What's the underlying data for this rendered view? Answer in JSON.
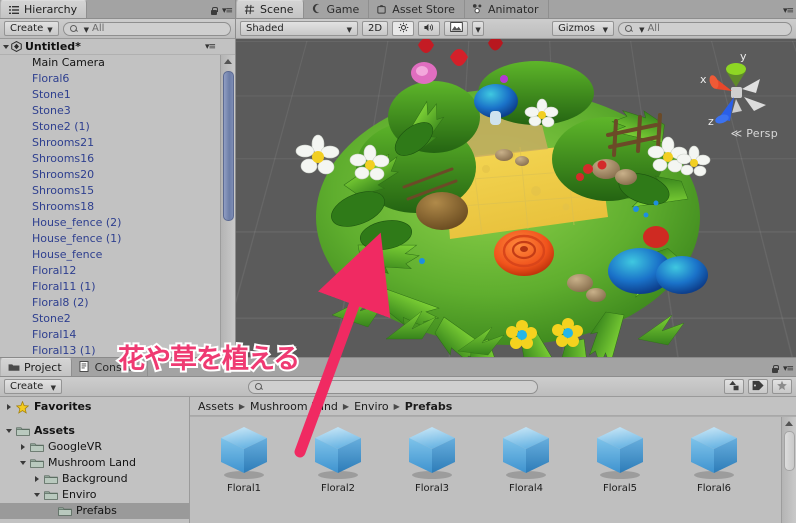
{
  "hierarchy": {
    "tab_label": "Hierarchy",
    "tab_icon": "hierarchy-icon",
    "create_label": "Create",
    "search_placeholder": "All",
    "scene_name": "Untitled*",
    "items": [
      {
        "label": "Main Camera",
        "kind": "gameobject"
      },
      {
        "label": "Floral6",
        "kind": "prefab"
      },
      {
        "label": "Stone1",
        "kind": "prefab"
      },
      {
        "label": "Stone3",
        "kind": "prefab"
      },
      {
        "label": "Stone2 (1)",
        "kind": "prefab"
      },
      {
        "label": "Shrooms21",
        "kind": "prefab"
      },
      {
        "label": "Shrooms16",
        "kind": "prefab"
      },
      {
        "label": "Shrooms20",
        "kind": "prefab"
      },
      {
        "label": "Shrooms15",
        "kind": "prefab"
      },
      {
        "label": "Shrooms18",
        "kind": "prefab"
      },
      {
        "label": "House_fence (2)",
        "kind": "prefab"
      },
      {
        "label": "House_fence (1)",
        "kind": "prefab"
      },
      {
        "label": "House_fence",
        "kind": "prefab"
      },
      {
        "label": "Floral12",
        "kind": "prefab"
      },
      {
        "label": "Floral11 (1)",
        "kind": "prefab"
      },
      {
        "label": "Floral8 (2)",
        "kind": "prefab"
      },
      {
        "label": "Stone2",
        "kind": "prefab"
      },
      {
        "label": "Floral14",
        "kind": "prefab"
      },
      {
        "label": "Floral13 (1)",
        "kind": "prefab"
      }
    ]
  },
  "scene_panel": {
    "tabs": [
      {
        "label": "Scene",
        "icon": "grid-icon",
        "active": true
      },
      {
        "label": "Game",
        "icon": "gamepad-icon",
        "active": false
      },
      {
        "label": "Asset Store",
        "icon": "store-bag-icon",
        "active": false
      },
      {
        "label": "Animator",
        "icon": "animator-icon",
        "active": false
      }
    ],
    "toolbar": {
      "draw_mode": "Shaded",
      "two_d_label": "2D",
      "lighting_icon": "sun-icon",
      "audio_icon": "speaker-icon",
      "fx_icon": "image-icon",
      "gizmos_label": "Gizmos",
      "search_placeholder": "All"
    },
    "gizmo": {
      "x_label": "x",
      "y_label": "y",
      "z_label": "z",
      "projection_label": "Persp",
      "x_color": "#e8472a",
      "y_color": "#8ed624",
      "z_color": "#2a5fe8"
    }
  },
  "project": {
    "tabs": [
      {
        "label": "Project",
        "icon": "folder-icon",
        "active": true
      },
      {
        "label": "Console",
        "icon": "console-icon",
        "active": false
      }
    ],
    "create_label": "Create",
    "search_placeholder": "",
    "filter_icons": [
      "shapes-filter-icon",
      "label-filter-icon",
      "favorite-filter-icon"
    ],
    "tree": [
      {
        "label": "Favorites",
        "depth": 0,
        "expander": "collapsed",
        "icon": "star-icon",
        "bold": true,
        "selected": false
      },
      {
        "label": "Assets",
        "depth": 0,
        "expander": "expanded",
        "icon": "folder-icon",
        "bold": true,
        "selected": false
      },
      {
        "label": "GoogleVR",
        "depth": 1,
        "expander": "collapsed",
        "icon": "folder-icon",
        "bold": false,
        "selected": false
      },
      {
        "label": "Mushroom Land",
        "depth": 1,
        "expander": "expanded",
        "icon": "folder-icon",
        "bold": false,
        "selected": false
      },
      {
        "label": "Background",
        "depth": 2,
        "expander": "collapsed",
        "icon": "folder-icon",
        "bold": false,
        "selected": false
      },
      {
        "label": "Enviro",
        "depth": 2,
        "expander": "expanded",
        "icon": "folder-icon",
        "bold": false,
        "selected": false
      },
      {
        "label": "Prefabs",
        "depth": 3,
        "expander": "none",
        "icon": "folder-icon",
        "bold": false,
        "selected": true
      }
    ],
    "breadcrumb": [
      "Assets",
      "Mushroom Land",
      "Enviro",
      "Prefabs"
    ],
    "assets": [
      {
        "label": "Floral1",
        "icon": "prefab-cube-icon"
      },
      {
        "label": "Floral2",
        "icon": "prefab-cube-icon"
      },
      {
        "label": "Floral3",
        "icon": "prefab-cube-icon"
      },
      {
        "label": "Floral4",
        "icon": "prefab-cube-icon"
      },
      {
        "label": "Floral5",
        "icon": "prefab-cube-icon"
      },
      {
        "label": "Floral6",
        "icon": "prefab-cube-icon"
      }
    ]
  },
  "annotation": {
    "text": "花や草を植える",
    "color": "#ef3a72",
    "outline_color": "#ffffff",
    "arrow_color": "#f02a62"
  }
}
